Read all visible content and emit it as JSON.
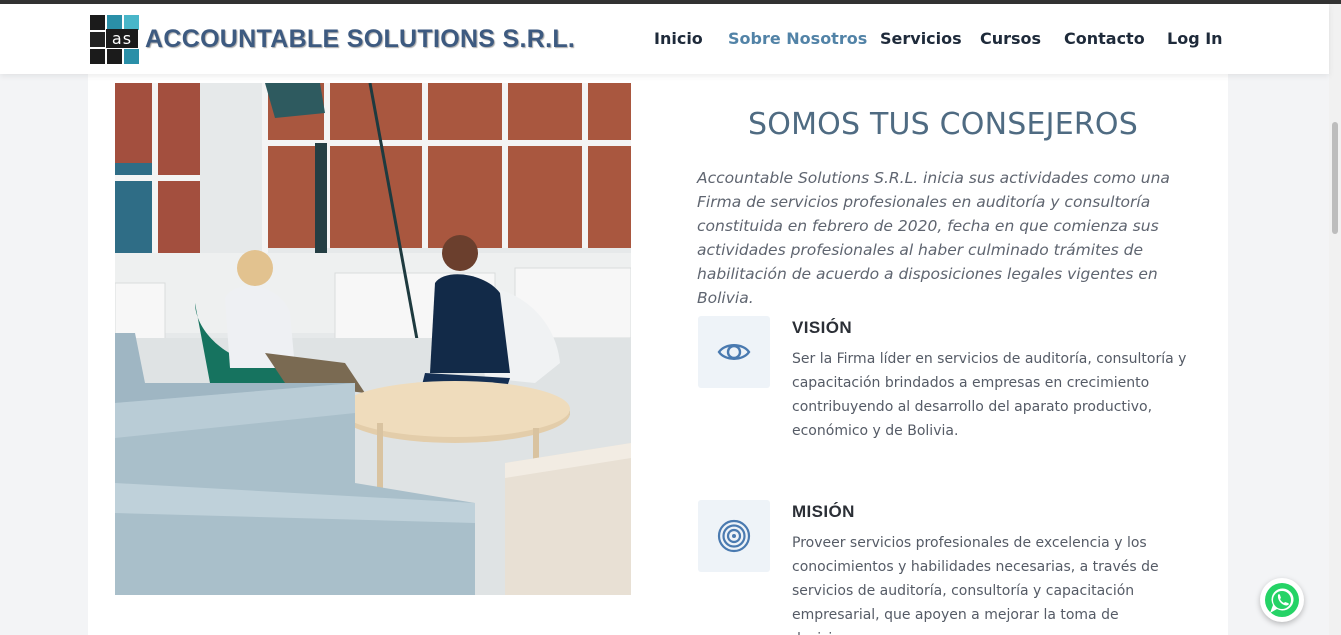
{
  "brand": {
    "logo_letters": "as",
    "name": "ACCOUNTABLE SOLUTIONS S.R.L."
  },
  "nav": {
    "items": [
      {
        "label": "Inicio"
      },
      {
        "label": "Sobre Nosotros",
        "active": true
      },
      {
        "label": "Servicios"
      },
      {
        "label": "Cursos"
      },
      {
        "label": "Contacto"
      },
      {
        "label": "Log In"
      }
    ]
  },
  "about": {
    "heading": "SOMOS TUS CONSEJEROS",
    "intro": "Accountable Solutions S.R.L. inicia sus actividades como una Firma de servicios profesionales en auditoría y consultoría constituida en febrero de 2020, fecha en que comienza sus actividades profesionales al haber culminado trámites de habilitación de acuerdo a disposiciones legales vigentes en Bolivia."
  },
  "features": [
    {
      "icon": "eye-icon",
      "title": "VISIÓN",
      "text": "Ser la Firma líder en servicios de auditoría, consultoría y capacitación brindados a empresas en crecimiento contribuyendo al desarrollo del aparato productivo, económico y de Bolivia."
    },
    {
      "icon": "target-icon",
      "title": "MISIÓN",
      "text": "Proveer servicios profesionales de excelencia y los conocimientos y habilidades necesarias, a través de servicios de auditoría, consultoría y capacitación empresarial, que apoyen a mejorar la toma de decisiones"
    }
  ],
  "colors": {
    "accent": "#5283a7",
    "brand": "#3d5a80",
    "heading": "#4f6b82",
    "icon": "#4a7ab0"
  },
  "whatsapp": {
    "icon": "whatsapp-icon"
  }
}
